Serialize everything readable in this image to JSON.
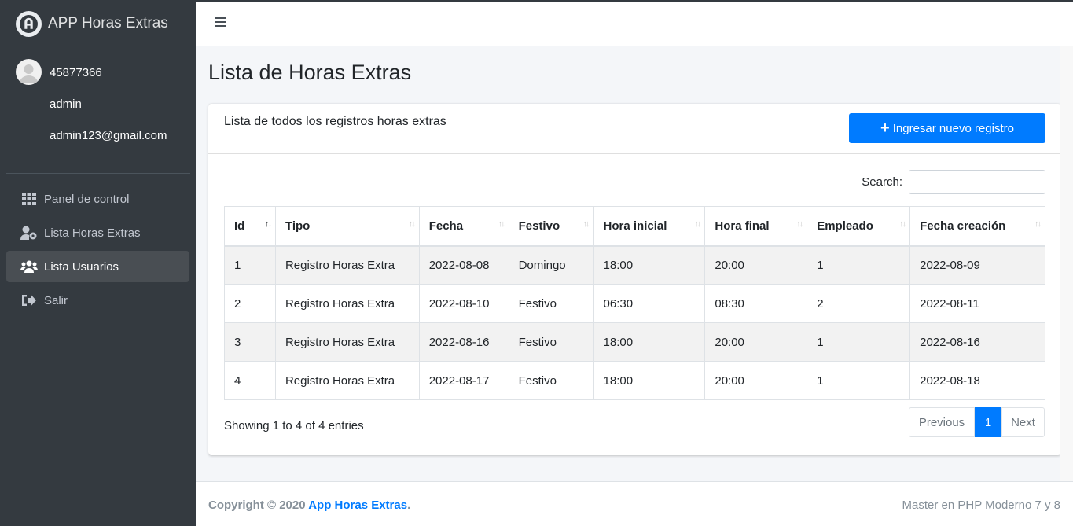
{
  "app": {
    "title": "APP Horas Extras"
  },
  "user": {
    "id": "45877366",
    "role": "admin",
    "email": "admin123@gmail.com"
  },
  "sidebar": {
    "items": [
      {
        "label": "Panel de control",
        "icon": "grid-icon"
      },
      {
        "label": "Lista Horas Extras",
        "icon": "user-cog-icon"
      },
      {
        "label": "Lista Usuarios",
        "icon": "users-icon",
        "active": true
      },
      {
        "label": "Salir",
        "icon": "sign-out-icon"
      }
    ]
  },
  "page": {
    "title": "Lista de Horas Extras",
    "card_title": "Lista de todos los registros horas extras",
    "new_button": "Ingresar nuevo registro",
    "search_label": "Search:"
  },
  "table": {
    "headers": [
      "Id",
      "Tipo",
      "Fecha",
      "Festivo",
      "Hora inicial",
      "Hora final",
      "Empleado",
      "Fecha creación"
    ],
    "rows": [
      [
        "1",
        "Registro Horas Extra",
        "2022-08-08",
        "Domingo",
        "18:00",
        "20:00",
        "1",
        "2022-08-09"
      ],
      [
        "2",
        "Registro Horas Extra",
        "2022-08-10",
        "Festivo",
        "06:30",
        "08:30",
        "2",
        "2022-08-11"
      ],
      [
        "3",
        "Registro Horas Extra",
        "2022-08-16",
        "Festivo",
        "18:00",
        "20:00",
        "1",
        "2022-08-16"
      ],
      [
        "4",
        "Registro Horas Extra",
        "2022-08-17",
        "Festivo",
        "18:00",
        "20:00",
        "1",
        "2022-08-18"
      ]
    ],
    "info": "Showing 1 to 4 of 4 entries"
  },
  "pagination": {
    "previous": "Previous",
    "current": "1",
    "next": "Next"
  },
  "footer": {
    "copyright": "Copyright © 2020 ",
    "app_link": "App Horas Extras",
    "period": ".",
    "right": "Master en PHP Moderno 7 y 8"
  },
  "colors": {
    "primary": "#007bff",
    "sidebar": "#343a40"
  }
}
